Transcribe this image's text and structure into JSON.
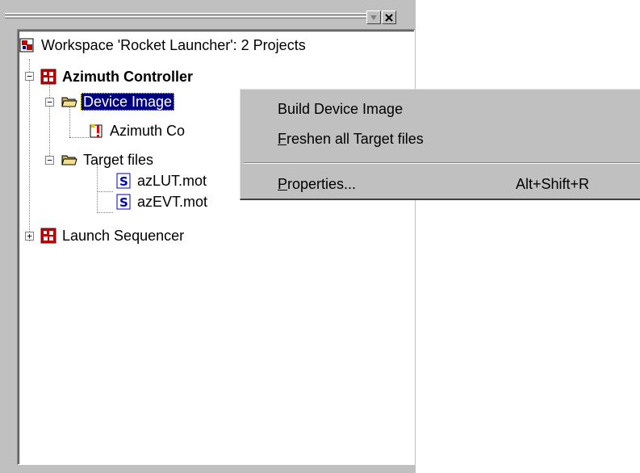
{
  "panel": {
    "buttons": [
      "minimize-button",
      "close-button"
    ]
  },
  "tree": {
    "workspace": "Workspace 'Rocket Launcher': 2 Projects",
    "project1": "Azimuth Controller",
    "device_image": "Device Image",
    "device_image_child": "Azimuth Co",
    "target_files": "Target files",
    "file1": "azLUT.mot",
    "file2": "azEVT.mot",
    "project2": "Launch Sequencer"
  },
  "menu": {
    "build": "Build Device Image",
    "freshen_mnemonic": "F",
    "freshen_rest": "reshen all Target files",
    "properties_mnemonic": "P",
    "properties_rest": "roperties...",
    "properties_shortcut": "Alt+Shift+R"
  },
  "colors": {
    "face": "#c0c0c0",
    "selection": "#000080"
  }
}
